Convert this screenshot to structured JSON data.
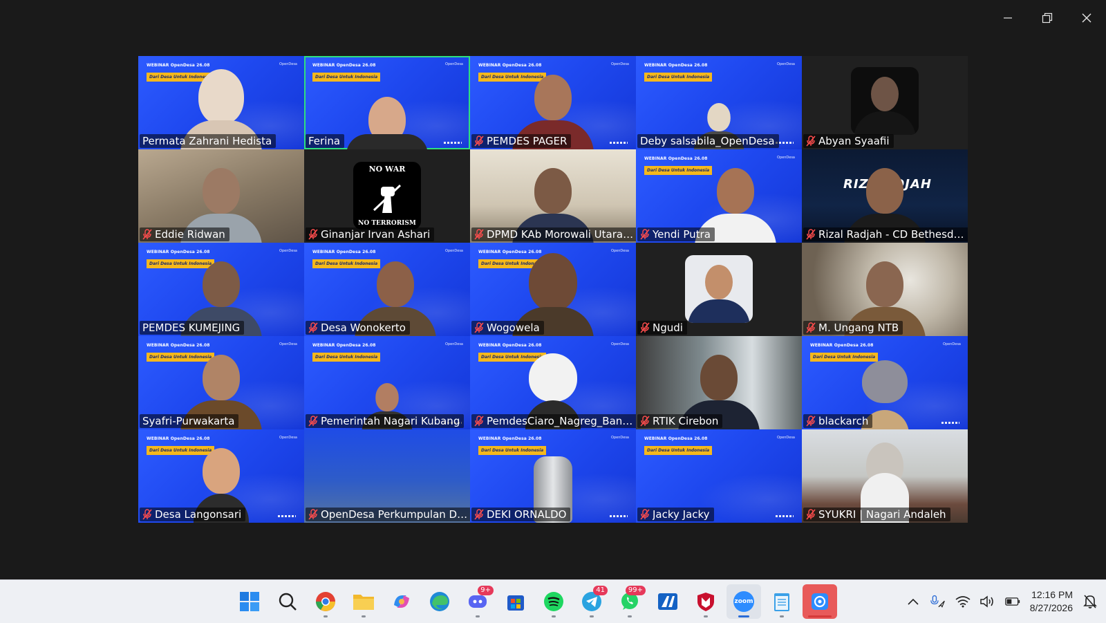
{
  "window": {
    "controls": [
      "minimize",
      "restore",
      "close"
    ]
  },
  "banner": {
    "title": "WEBINAR OpenDesa 26.08",
    "tagline": "Dari Desa Untuk Indonesia",
    "brand": "OpenDesa"
  },
  "participants": [
    {
      "name": "Permata Zahrani Hedista",
      "muted": false
    },
    {
      "name": "Ferina",
      "muted": false
    },
    {
      "name": "PEMDES PAGER",
      "muted": true
    },
    {
      "name": "Deby salsabila_OpenDesa",
      "muted": false
    },
    {
      "name": "Abyan Syaafii",
      "muted": true
    },
    {
      "name": "Eddie Ridwan",
      "muted": true
    },
    {
      "name": "Ginanjar Irvan Ashari",
      "muted": true
    },
    {
      "name": "DPMD KAb Morowali Utara ...",
      "muted": true
    },
    {
      "name": "Yendi Putra",
      "muted": true
    },
    {
      "name": "Rizal Radjah - CD Bethesda ...",
      "muted": true
    },
    {
      "name": "PEMDES KUMEJING",
      "muted": false
    },
    {
      "name": "Desa Wonokerto",
      "muted": true
    },
    {
      "name": "Wogowela",
      "muted": true
    },
    {
      "name": "Ngudi",
      "muted": true
    },
    {
      "name": "M. Ungang NTB",
      "muted": true
    },
    {
      "name": "Syafri-Purwakarta",
      "muted": false
    },
    {
      "name": "Pemerintah Nagari Kubang",
      "muted": true
    },
    {
      "name": "PemdesCiaro_Nagreg_Band...",
      "muted": true
    },
    {
      "name": "RTIK Cirebon",
      "muted": true
    },
    {
      "name": "blackarch",
      "muted": true
    },
    {
      "name": "Desa Langonsari",
      "muted": true
    },
    {
      "name": "OpenDesa Perkumpulan Des...",
      "muted": true
    },
    {
      "name": "DEKI ORNALDO",
      "muted": true
    },
    {
      "name": "Jacky Jacky",
      "muted": true
    },
    {
      "name": "SYUKRI | Nagari Andaleh",
      "muted": true
    }
  ],
  "tile_art": {
    "no_war_top": "NO WAR",
    "no_war_bottom": "NO TERRORISM",
    "rizal_bg": "RIZ   ADJAH"
  },
  "taskbar": {
    "apps": [
      {
        "name": "start-menu",
        "icon": "windows-icon"
      },
      {
        "name": "search",
        "icon": "search-icon"
      },
      {
        "name": "chrome",
        "icon": "chrome-icon"
      },
      {
        "name": "file-explorer",
        "icon": "folder-icon"
      },
      {
        "name": "copilot",
        "icon": "copilot-icon"
      },
      {
        "name": "edge",
        "icon": "edge-icon"
      },
      {
        "name": "discord",
        "icon": "discord-icon",
        "badge": "9+"
      },
      {
        "name": "microsoft-store",
        "icon": "store-icon"
      },
      {
        "name": "spotify",
        "icon": "spotify-icon"
      },
      {
        "name": "telegram",
        "icon": "telegram-icon",
        "badge": "41"
      },
      {
        "name": "whatsapp",
        "icon": "whatsapp-icon",
        "badge": "99+"
      },
      {
        "name": "app-a",
        "icon": "a-icon"
      },
      {
        "name": "mcafee",
        "icon": "shield-icon"
      },
      {
        "name": "zoom",
        "icon": "zoom-icon",
        "label": "zoom"
      },
      {
        "name": "notepad",
        "icon": "notepad-icon"
      },
      {
        "name": "zoom-meeting",
        "icon": "camera-icon"
      }
    ],
    "clock": {
      "time": "12:16 PM",
      "date": "8/27/2026"
    }
  }
}
